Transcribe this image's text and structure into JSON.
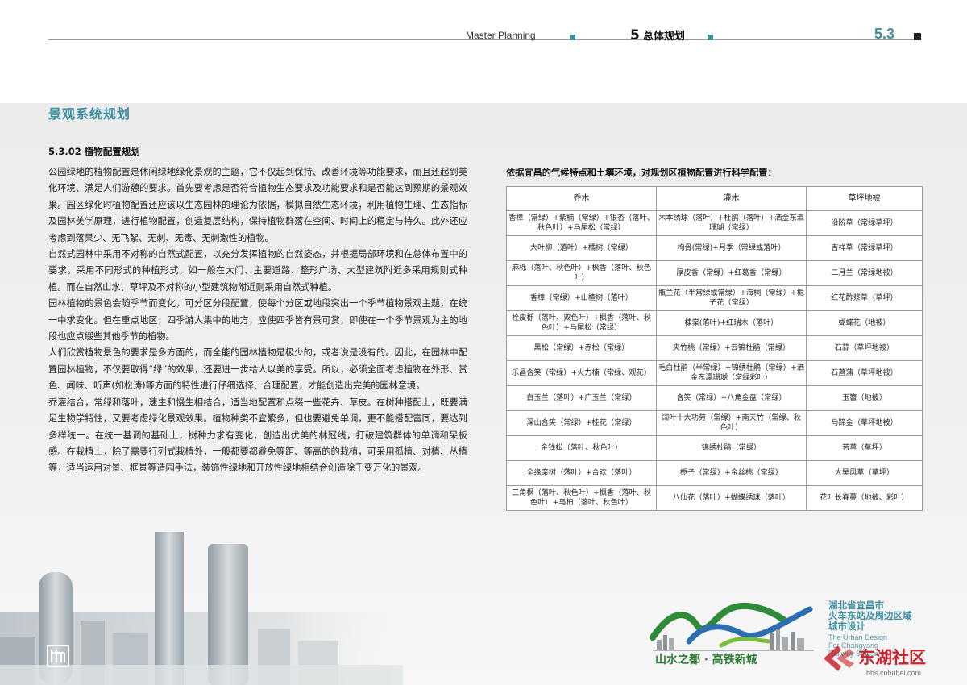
{
  "header": {
    "en_title": "Master Planning",
    "chapter_num": "5",
    "chapter_title": "总体规划",
    "page_num": "5.3"
  },
  "section_title": "景观系统规划",
  "subsection_title": "5.3.02 植物配置规划",
  "paragraphs": [
    "公园绿地的植物配置是休闲绿地绿化景观的主题，它不仅起到保持、改善环境等功能要求，而且还起到美化环境、满足人们游憩的要求。首先要考虑是否符合植物生态要求及功能要求和是否能达到预期的景观效果。园区绿化时植物配置还应该以生态园林的理论为依据，模拟自然生态环境，利用植物生理、生态指标及园林美学原理，进行植物配置，创造复层结构，保持植物群落在空间、时间上的稳定与持久。此外还应考虑到落果少、无飞絮、无刺、无毒、无刺激性的植物。",
    "自然式园林中采用不对称的自然式配置，以充分发挥植物的自然姿态，并根据局部环境和在总体布置中的要求，采用不同形式的种植形式，如一般在大门、主要道路、整形广场、大型建筑附近多采用规则式种植。而在自然山水、草坪及不对称的小型建筑物附近则采用自然式种植。",
    "园林植物的景色会随季节而变化，可分区分段配置，使每个分区或地段突出一个季节植物景观主题，在统一中求变化。但在重点地区，四季游人集中的地方，应使四季皆有景可赏，即使在一个季节景观为主的地段也应点缀些其他季节的植物。",
    "人们欣赏植物景色的要求是多方面的，而全能的园林植物是极少的，或者说是没有的。因此，在园林中配置园林植物，不仅要取得“绿”的效果，还要进一步给人以美的享受。所以，必须全面考虑植物在外形、赏色、闻味、听声(如松涛)等方面的特性进行仔细选择、合理配置，才能创造出完美的园林意境。",
    "乔灌结合，常绿和落叶，速生和慢生相结合，适当地配置和点缀一些花卉、草皮。在树种搭配上，既要满足生物学特性，又要考虑绿化景观效果。植物种类不宜繁多，但也要避免单调，更不能搭配雷同，要达到多样统一。在统一基调的基础上，树种力求有变化，创造出优美的林冠线，打破建筑群体的单调和呆板感。在栽植上，除了需要行列式栽植外，一般都要都避免等距、等高的的栽植，可采用孤植、对植、丛植等，适当运用对景、框景等造园手法，装饰性绿地和开放性绿地相结合创造除千变万化的景观。"
  ],
  "table_intro": "依据宜昌的气候特点和土壤环境，对规划区植物配置进行科学配置：",
  "table": {
    "headers": [
      "乔木",
      "灌木",
      "草坪地被"
    ],
    "rows": [
      [
        "香樟（常绿）+紫楠（常绿）+银杏（落叶、秋色叶）+马尾松（常绿）",
        "木本绣球（落叶）+杜鹃（落叶）+洒金东瀛珊瑚（常绿）",
        "沿阶草（常绿草坪）"
      ],
      [
        "大叶柳（落叶）+橘树（常绿）",
        "枸骨(常绿)+月季（常绿或落叶）",
        "吉祥草（常绿草坪）"
      ],
      [
        "麻栎（落叶、秋色叶）+枫香（落叶、秋色叶）",
        "厚皮香（常绿）+红葛香（常绿）",
        "二月兰（常绿地被）"
      ],
      [
        "香樟（常绿）+山楂树（落叶）",
        "瓶兰花（半常绿或常绿）+海桐（常绿）+栀子花（常绿）",
        "红花酢浆草（草坪）"
      ],
      [
        "栓皮栎（落叶、双色叶）+枫香（落叶、秋色叶）+马尾松（常绿）",
        "棣棠(落叶)+红瑞木（落叶）",
        "蝴蝶花（地被）"
      ],
      [
        "黑松（常绿）+赤松（常绿）",
        "夹竹桃（常绿）+云锦杜鹃（常绿）",
        "石蒜（草坪地被）"
      ],
      [
        "乐昌含笑（常绿）+火力楠（常绿、观花）",
        "毛白杜鹃（半常绿）+锦绣杜鹃（常绿）+洒金东瀛珊瑚（常绿彩叶）",
        "石菖蒲（草坪地被）"
      ],
      [
        "白玉兰（落叶）+广玉兰（常绿）",
        "含笑（常绿）+八角金盘（常绿）",
        "玉簪（地被）"
      ],
      [
        "深山含笑（常绿）+桂花（常绿）",
        "阔叶十大功劳（常绿）+南天竹（常绿、秋色叶）",
        "马蹄金（草坪地被）"
      ],
      [
        "金钱松（落叶、秋色叶）",
        "锦绣杜鹃（常绿）",
        "苔草（草坪）"
      ],
      [
        "全缘栾树（落叶）+合欢（落叶）",
        "栀子（常绿）+金丝桃（常绿）",
        "大吴风草（草坪）"
      ],
      [
        "三角枫（落叶、秋色叶）+枫香（落叶、秋色叶）+乌桕（落叶、秋色叶）",
        "八仙花（落叶）+蝴蝶绣球（落叶）",
        "花叶长春蔓（地被、彩叶）"
      ]
    ]
  },
  "logo": {
    "title_lines": [
      "湖北省宜昌市",
      "火车东站及周边区域",
      "城市设计"
    ],
    "en_lines": [
      "The Urban Design",
      "For Changyang",
      "Railway Station of Y"
    ],
    "slogan": "山水之都 · 高铁新城"
  },
  "watermark": {
    "name": "东湖社区",
    "url": "bbs.cnhubei.com"
  },
  "colors": {
    "accent": "#3d8fa0",
    "slogan": "#2e7a34",
    "watermark": "#c8232c"
  }
}
